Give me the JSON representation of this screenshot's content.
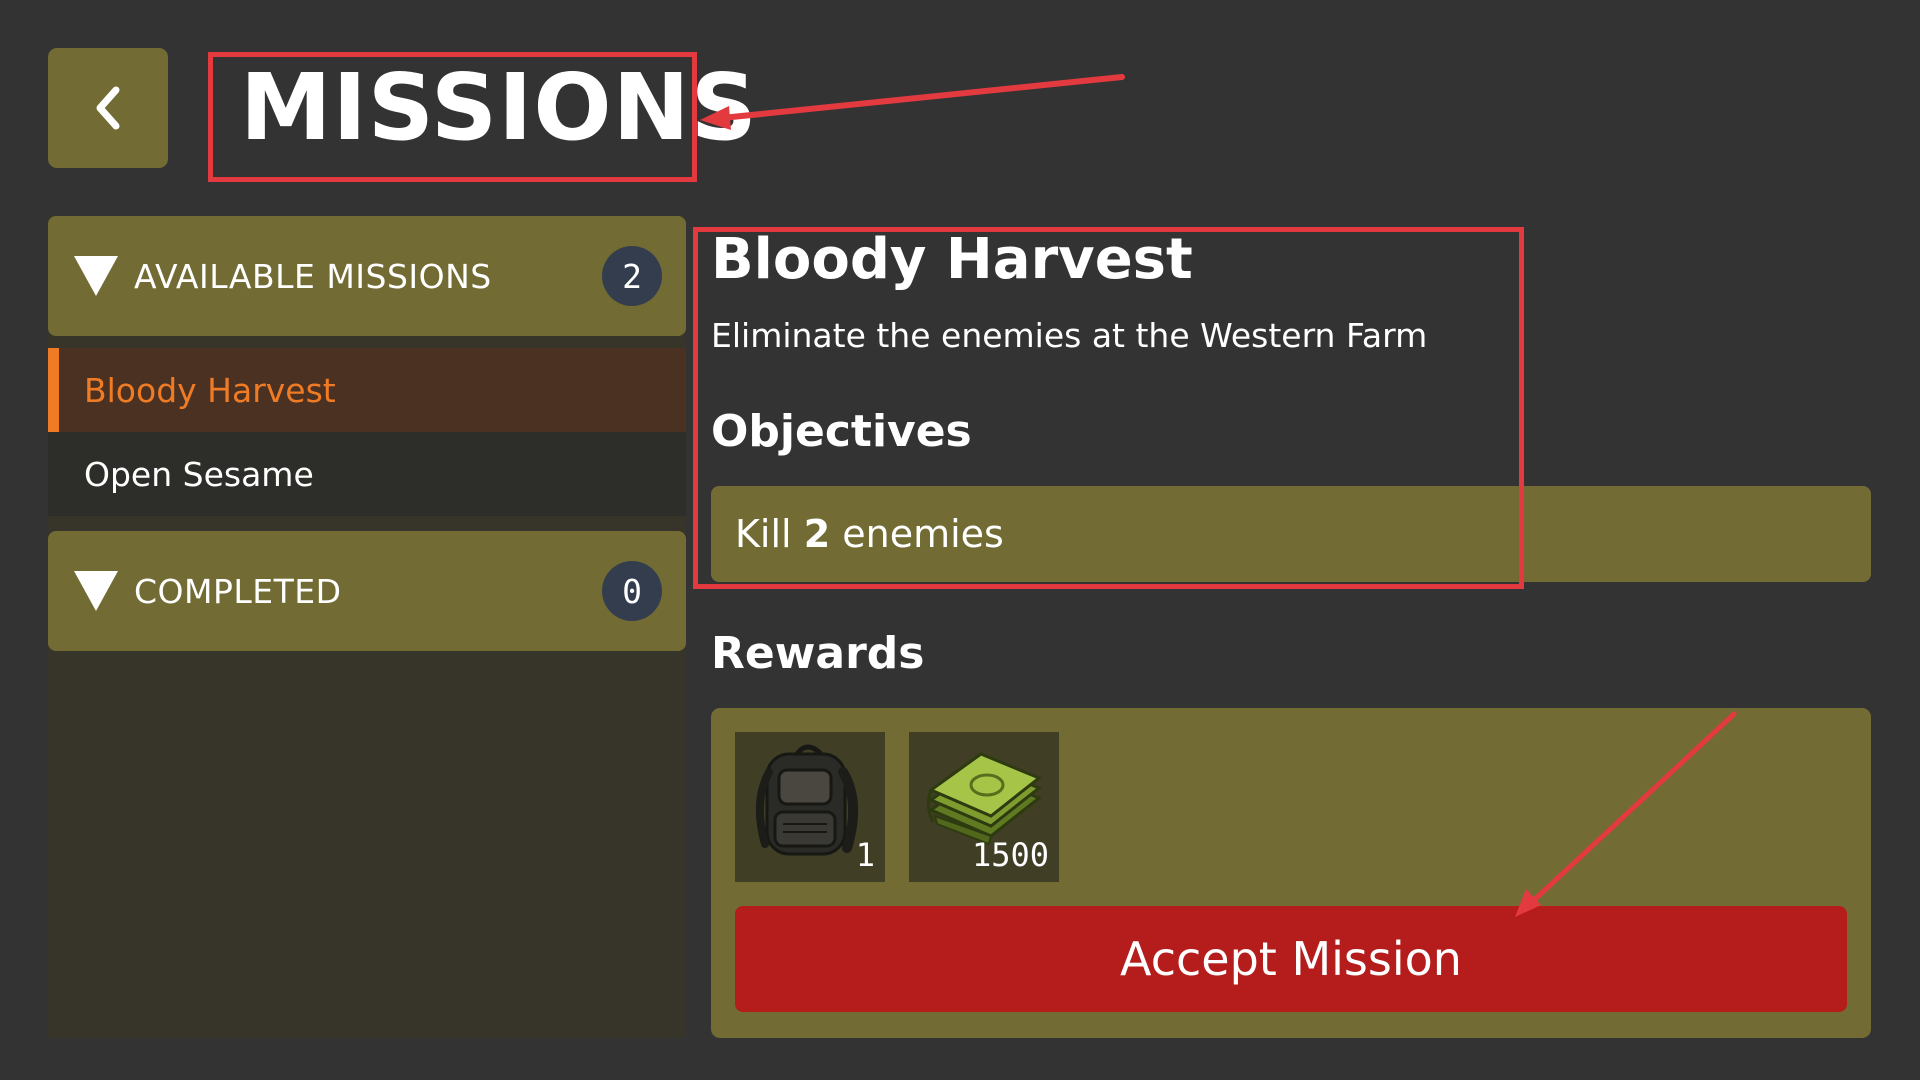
{
  "header": {
    "title": "MISSIONS"
  },
  "sidebar": {
    "categories": [
      {
        "label": "AVAILABLE MISSIONS",
        "count": "2",
        "expanded": true
      },
      {
        "label": "COMPLETED",
        "count": "0",
        "expanded": true
      }
    ],
    "missions": [
      {
        "label": "Bloody Harvest",
        "selected": true
      },
      {
        "label": "Open Sesame",
        "selected": false
      }
    ]
  },
  "detail": {
    "title": "Bloody Harvest",
    "description": "Eliminate the enemies at the Western Farm",
    "objectives_heading": "Objectives",
    "objective": {
      "prefix": "Kill",
      "amount": "2",
      "suffix": "enemies"
    },
    "rewards_heading": "Rewards",
    "rewards": [
      {
        "icon": "backpack-icon",
        "quantity": "1"
      },
      {
        "icon": "cash-bundle-icon",
        "quantity": "1500"
      }
    ],
    "accept_label": "Accept Mission"
  },
  "colors": {
    "background": "#333333",
    "panel_olive": "#726b33",
    "selected_accent": "#f07b25",
    "accept_red": "#b51c1c",
    "annotation_red": "#e33a3f",
    "badge_blue": "#333d4e"
  }
}
